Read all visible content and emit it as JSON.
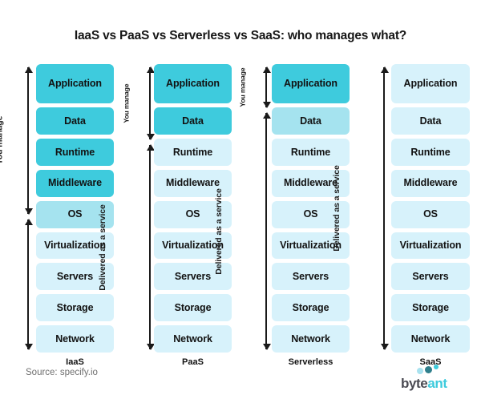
{
  "title": "IaaS vs PaaS vs Serverless vs SaaS: who manages what?",
  "source": "Source: specify.io",
  "logo": {
    "word_part_1": "byte",
    "word_part_2": "ant",
    "dot_colors": [
      "#a8e2ef",
      "#2f7f8c",
      "#3ecbdd"
    ]
  },
  "colors": {
    "managed_by_you": "#3ecbdd",
    "partial": "#a5e3ef",
    "delivered_as_service": "#d7f2fb",
    "text": "#121212",
    "arrow": "#1a1a1a"
  },
  "labels": {
    "you_manage": "You manage",
    "delivered_as_a_service": "Delivered as a service"
  },
  "layer_names": [
    "Application",
    "Data",
    "Runtime",
    "Middleware",
    "OS",
    "Virtualization",
    "Servers",
    "Storage",
    "Network"
  ],
  "chart_data": {
    "type": "table",
    "title": "IaaS vs PaaS vs Serverless vs SaaS: who manages what?",
    "categories": [
      "IaaS",
      "PaaS",
      "Serverless",
      "SaaS"
    ],
    "rows": [
      "Application",
      "Data",
      "Runtime",
      "Middleware",
      "OS",
      "Virtualization",
      "Servers",
      "Storage",
      "Network"
    ],
    "legend": [
      "You manage",
      "Delivered as a service"
    ],
    "values": {
      "IaaS": [
        "you",
        "you",
        "you",
        "you",
        "partial",
        "service",
        "service",
        "service",
        "service"
      ],
      "PaaS": [
        "you",
        "you",
        "service",
        "service",
        "service",
        "service",
        "service",
        "service",
        "service"
      ],
      "Serverless": [
        "you",
        "partial",
        "service",
        "service",
        "service",
        "service",
        "service",
        "service",
        "service"
      ],
      "SaaS": [
        "service",
        "service",
        "service",
        "service",
        "service",
        "service",
        "service",
        "service",
        "service"
      ]
    }
  },
  "columns": [
    {
      "id": "iaas",
      "label": "IaaS",
      "layers": [
        {
          "name": "Application",
          "shade": "dark"
        },
        {
          "name": "Data",
          "shade": "dark"
        },
        {
          "name": "Runtime",
          "shade": "dark"
        },
        {
          "name": "Middleware",
          "shade": "dark"
        },
        {
          "name": "OS",
          "shade": "medium"
        },
        {
          "name": "Virtualization",
          "shade": "light"
        },
        {
          "name": "Servers",
          "shade": "light"
        },
        {
          "name": "Storage",
          "shade": "light"
        },
        {
          "name": "Network",
          "shade": "light"
        }
      ],
      "arrows": [
        {
          "label": "You manage",
          "top_pct": 1,
          "height_pct": 51
        },
        {
          "label": "Delivered as a service",
          "top_pct": 54,
          "height_pct": 45
        }
      ]
    },
    {
      "id": "paas",
      "label": "PaaS",
      "layers": [
        {
          "name": "Application",
          "shade": "dark"
        },
        {
          "name": "Data",
          "shade": "dark"
        },
        {
          "name": "Runtime",
          "shade": "light"
        },
        {
          "name": "Middleware",
          "shade": "light"
        },
        {
          "name": "OS",
          "shade": "light"
        },
        {
          "name": "Virtualization",
          "shade": "light"
        },
        {
          "name": "Servers",
          "shade": "light"
        },
        {
          "name": "Storage",
          "shade": "light"
        },
        {
          "name": "Network",
          "shade": "light"
        }
      ],
      "arrows": [
        {
          "label": "You manage",
          "top_pct": 1,
          "height_pct": 25
        },
        {
          "label": "Delivered as a service",
          "top_pct": 28,
          "height_pct": 71
        }
      ]
    },
    {
      "id": "serverless",
      "label": "Serverless",
      "layers": [
        {
          "name": "Application",
          "shade": "dark"
        },
        {
          "name": "Data",
          "shade": "medium"
        },
        {
          "name": "Runtime",
          "shade": "light"
        },
        {
          "name": "Middleware",
          "shade": "light"
        },
        {
          "name": "OS",
          "shade": "light"
        },
        {
          "name": "Virtualization",
          "shade": "light"
        },
        {
          "name": "Servers",
          "shade": "light"
        },
        {
          "name": "Storage",
          "shade": "light"
        },
        {
          "name": "Network",
          "shade": "light"
        }
      ],
      "arrows": [
        {
          "label": "You manage",
          "top_pct": 1,
          "height_pct": 14
        },
        {
          "label": "Delivered as a service",
          "top_pct": 17,
          "height_pct": 82
        }
      ]
    },
    {
      "id": "saas",
      "label": "SaaS",
      "layers": [
        {
          "name": "Application",
          "shade": "light"
        },
        {
          "name": "Data",
          "shade": "light"
        },
        {
          "name": "Runtime",
          "shade": "light"
        },
        {
          "name": "Middleware",
          "shade": "light"
        },
        {
          "name": "OS",
          "shade": "light"
        },
        {
          "name": "Virtualization",
          "shade": "light"
        },
        {
          "name": "Servers",
          "shade": "light"
        },
        {
          "name": "Storage",
          "shade": "light"
        },
        {
          "name": "Network",
          "shade": "light"
        }
      ],
      "arrows": [
        {
          "label": "Delivered as a service",
          "top_pct": 1,
          "height_pct": 98
        }
      ]
    }
  ]
}
